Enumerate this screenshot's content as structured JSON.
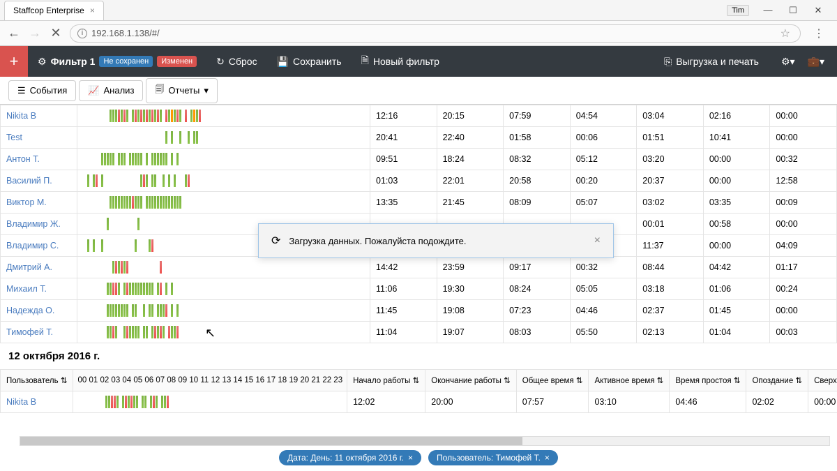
{
  "browser": {
    "tab_title": "Staffcop Enterprise",
    "user_badge": "Tim",
    "url": "192.168.1.138/#/"
  },
  "app": {
    "filter_label": "Фильтр 1",
    "not_saved": "Не сохранен",
    "changed": "Изменен",
    "reset": "Сброс",
    "save": "Сохранить",
    "new_filter": "Новый фильтр",
    "export": "Выгрузка и печать"
  },
  "tabs": {
    "events": "События",
    "analysis": "Анализ",
    "reports": "Отчеты"
  },
  "columns": {
    "user": "Пользователь",
    "start": "Начало работы",
    "end": "Окончание работы",
    "total": "Общее время",
    "active": "Активное время",
    "idle": "Время простоя",
    "late": "Опоздание",
    "overtime": "Сверхурочные"
  },
  "rows": [
    {
      "user": "Nikita B",
      "c": [
        "12:16",
        "20:15",
        "07:59",
        "04:54",
        "03:04",
        "02:16",
        "00:00"
      ]
    },
    {
      "user": "Test",
      "c": [
        "20:41",
        "22:40",
        "01:58",
        "00:06",
        "01:51",
        "10:41",
        "00:00"
      ]
    },
    {
      "user": "Антон Т.",
      "c": [
        "09:51",
        "18:24",
        "08:32",
        "05:12",
        "03:20",
        "00:00",
        "00:32"
      ]
    },
    {
      "user": "Василий П.",
      "c": [
        "01:03",
        "22:01",
        "20:58",
        "00:20",
        "20:37",
        "00:00",
        "12:58"
      ]
    },
    {
      "user": "Виктор М.",
      "c": [
        "13:35",
        "21:45",
        "08:09",
        "05:07",
        "03:02",
        "03:35",
        "00:09"
      ]
    },
    {
      "user": "Владимир Ж.",
      "c": [
        "",
        "",
        "",
        "",
        "00:01",
        "00:58",
        "00:00"
      ]
    },
    {
      "user": "Владимир С.",
      "c": [
        "",
        "",
        "",
        "",
        "11:37",
        "00:00",
        "04:09"
      ]
    },
    {
      "user": "Дмитрий А.",
      "c": [
        "14:42",
        "23:59",
        "09:17",
        "00:32",
        "08:44",
        "04:42",
        "01:17"
      ]
    },
    {
      "user": "Михаил Т.",
      "c": [
        "11:06",
        "19:30",
        "08:24",
        "05:05",
        "03:18",
        "01:06",
        "00:24"
      ]
    },
    {
      "user": "Надежда О.",
      "c": [
        "11:45",
        "19:08",
        "07:23",
        "04:46",
        "02:37",
        "01:45",
        "00:00"
      ]
    },
    {
      "user": "Тимофей Т.",
      "c": [
        "11:04",
        "19:07",
        "08:03",
        "05:50",
        "02:13",
        "01:04",
        "00:03"
      ]
    }
  ],
  "section2_title": "12 октября 2016 г.",
  "hours": [
    "00",
    "01",
    "02",
    "03",
    "04",
    "05",
    "06",
    "07",
    "08",
    "09",
    "10",
    "11",
    "12",
    "13",
    "14",
    "15",
    "16",
    "17",
    "18",
    "19",
    "20",
    "21",
    "22",
    "23"
  ],
  "rows2": [
    {
      "user": "Nikita B",
      "c": [
        "12:02",
        "20:00",
        "07:57",
        "03:10",
        "04:46",
        "02:02",
        "00:00"
      ]
    }
  ],
  "modal": {
    "text": "Загрузка данных. Пожалуйста подождите."
  },
  "chips": {
    "date": "Дата: День: 11 октября 2016 г.",
    "user": "Пользователь: Тимофей Т."
  },
  "bar_patterns": [
    "..........gggrgrg.grgrgrgrgrg.rgogrg.r.gogr..",
    "..............................g.g..g..g.gg...",
    ".......ggggg.ggg.ggggg.g.gggggg.g.g..........",
    "..g.gr.g.............grg.gg..g.g.g...gr......",
    "..........ggggggggrggg.ggggggggggggg.........",
    ".........g..........g........................",
    "..g.g..g...........g....gr...................",
    "...........grgrgr...........r................",
    ".........ggrrg.grggggggggg.gr.g.g............",
    ".........gggggggg.gg..g.gg.gggr.g.g..........",
    ".........ggrg..grgggg.gg.grgrg.rggr..........",
    "..........ggrrg.grgrgg.gg.grg.ggr............"
  ]
}
